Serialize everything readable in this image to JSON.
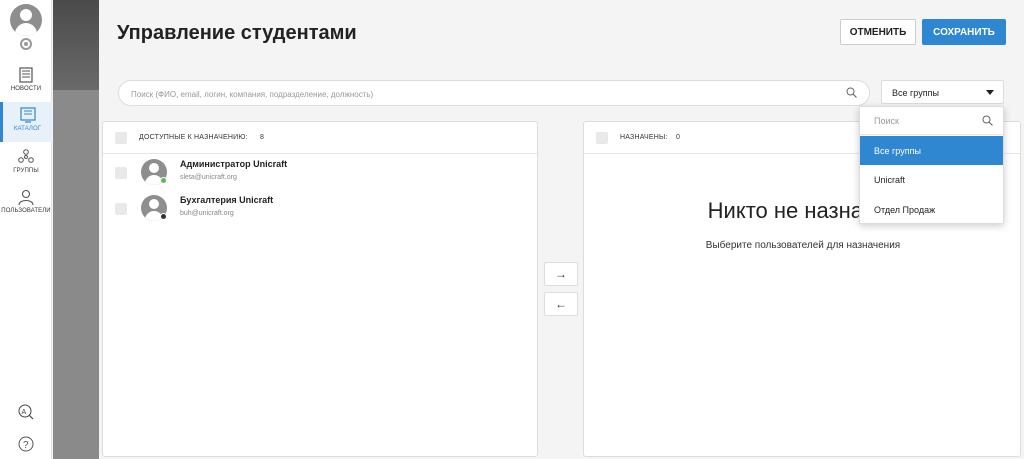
{
  "sidebar": {
    "items": [
      {
        "label": "НОВОСТИ",
        "icon": "news-icon"
      },
      {
        "label": "КАТАЛОГ",
        "icon": "catalog-icon"
      },
      {
        "label": "ГРУППЫ",
        "icon": "groups-icon"
      },
      {
        "label": "ПОЛЬЗОВАТЕЛИ",
        "icon": "users-icon"
      }
    ],
    "active_index": 1
  },
  "header": {
    "title": "Управление студентами",
    "cancel_label": "ОТМЕНИТЬ",
    "save_label": "СОХРАНИТЬ"
  },
  "search": {
    "placeholder": "Поиск (ФИО, email, логин, компания, подразделение, должность)"
  },
  "group_filter": {
    "selected": "Все группы"
  },
  "dropdown": {
    "search_placeholder": "Поиск",
    "options": [
      "Все группы",
      "Unicraft",
      "Отдел Продаж"
    ],
    "selected_index": 0
  },
  "available": {
    "label": "ДОСТУПНЫЕ К НАЗНАЧЕНИЮ:",
    "count": "8",
    "users": [
      {
        "name": "Администратор Unicraft",
        "email": "sleta@unicraft.org",
        "status_color": "#5cb85c"
      },
      {
        "name": "Бухгалтерия Unicraft",
        "email": "buh@unicraft.org",
        "status_color": "#333333"
      }
    ]
  },
  "assigned": {
    "label": "НАЗНАЧЕНЫ:",
    "count": "0",
    "empty_title": "Никто не назначен",
    "empty_subtitle": "Выберите пользователей для назначения"
  },
  "transfer": {
    "right_arrow": "→",
    "left_arrow": "←"
  },
  "colors": {
    "accent": "#2f86d1"
  }
}
